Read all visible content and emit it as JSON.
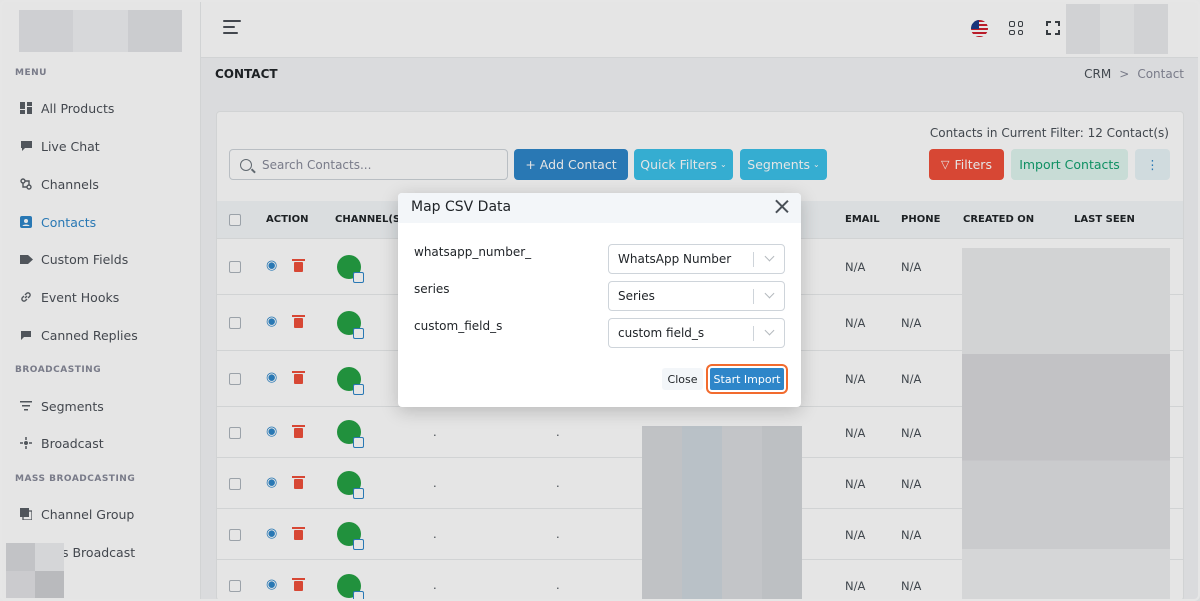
{
  "sidebar": {
    "sections": [
      "MENU",
      "BROADCASTING",
      "MASS BROADCASTING"
    ],
    "items": [
      {
        "label": "All Products",
        "icon": "dashboard-icon"
      },
      {
        "label": "Live Chat",
        "icon": "chat-icon"
      },
      {
        "label": "Channels",
        "icon": "channels-icon"
      },
      {
        "label": "Contacts",
        "icon": "contacts-icon",
        "active": true
      },
      {
        "label": "Custom Fields",
        "icon": "tag-icon"
      },
      {
        "label": "Event Hooks",
        "icon": "link-icon"
      },
      {
        "label": "Canned Replies",
        "icon": "canned-reply-icon"
      },
      {
        "label": "Segments",
        "icon": "segments-icon"
      },
      {
        "label": "Broadcast",
        "icon": "broadcast-icon"
      },
      {
        "label": "Channel Group",
        "icon": "channel-group-icon"
      },
      {
        "label": "s Broadcast",
        "icon": "broadcast-icon"
      }
    ]
  },
  "header": {
    "page_title": "CONTACT",
    "breadcrumb": [
      "CRM",
      "Contact"
    ]
  },
  "toolbar": {
    "filter_count": "Contacts in Current Filter: 12 Contact(s)",
    "search_placeholder": "Search Contacts...",
    "add_contact": "+ Add Contact",
    "quick_filters": "Quick Filters",
    "segments": "Segments",
    "filters": "Filters",
    "import_contacts": "Import Contacts",
    "more": "⋮"
  },
  "table": {
    "columns": [
      "ACTION",
      "CHANNEL(S)",
      "EMAIL",
      "PHONE",
      "CREATED ON",
      "LAST SEEN"
    ],
    "rows": [
      {
        "email": "N/A",
        "phone": "N/A",
        "name": "",
        "extra": ""
      },
      {
        "email": "N/A",
        "phone": "N/A",
        "name": "",
        "extra": ""
      },
      {
        "email": "N/A",
        "phone": "N/A",
        "name": "",
        "extra": ""
      },
      {
        "email": "N/A",
        "phone": "N/A",
        "name": ".",
        "extra": "."
      },
      {
        "email": "N/A",
        "phone": "N/A",
        "name": ".",
        "extra": "."
      },
      {
        "email": "N/A",
        "phone": "N/A",
        "name": ".",
        "extra": "."
      },
      {
        "email": "N/A",
        "phone": "N/A",
        "name": ".",
        "extra": "."
      }
    ]
  },
  "modal": {
    "title": "Map CSV Data",
    "mappings": [
      {
        "field": "whatsapp_number_",
        "value": "WhatsApp Number"
      },
      {
        "field": "series",
        "value": "Series"
      },
      {
        "field": "custom_field_s",
        "value": "custom field_s"
      }
    ],
    "close_label": "Close",
    "start_import_label": "Start Import"
  },
  "colors": {
    "primary": "#2e86c9",
    "danger": "#f0503a",
    "whatsapp": "#25a244",
    "highlight": "#f26b2e"
  }
}
